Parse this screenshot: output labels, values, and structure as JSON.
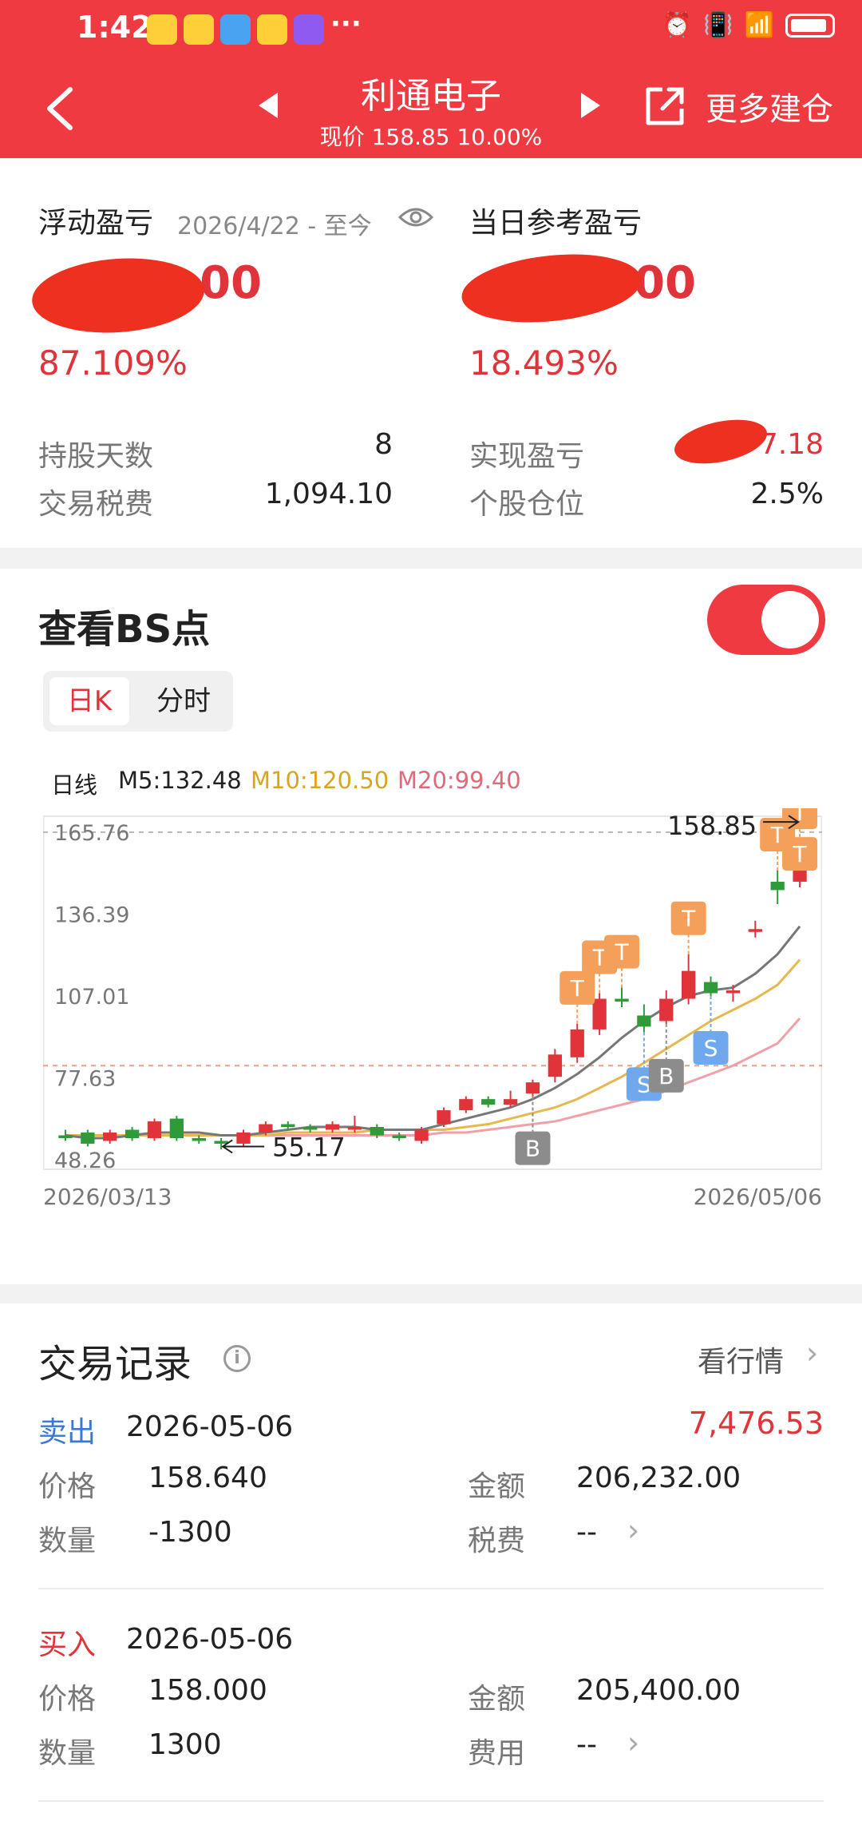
{
  "status_bar": {
    "time": "1:42",
    "notification_dots": "···"
  },
  "nav": {
    "title": "利通电子",
    "subtitle": "现价 158.85 10.00%",
    "more_label": "更多建仓"
  },
  "summary": {
    "floating_label": "浮动盈亏",
    "floating_range": "2026/4/22 - 至今",
    "floating_value_tail": ".00",
    "floating_pct": "87.109%",
    "daily_label": "当日参考盈亏",
    "daily_value_tail": "00",
    "daily_pct": "18.493%",
    "hold_days_label": "持股天数",
    "hold_days": "8",
    "fees_label": "交易税费",
    "fees": "1,094.10",
    "realized_label": "实现盈亏",
    "realized_tail": "7.18",
    "position_label": "个股仓位",
    "position": "2.5%"
  },
  "bs": {
    "title": "查看BS点",
    "tab_day": "日K",
    "tab_intraday": "分时",
    "ma_prefix": "日线",
    "ma5": "M5:132.48",
    "ma10": "M10:120.50",
    "ma20": "M20:99.40",
    "colors": {
      "up": "#e0343a",
      "down": "#2e9a3a",
      "ma5": "#777777",
      "ma10": "#e8b850",
      "ma20": "#f0a0a8",
      "t_marker": "#f5a05a",
      "buy_marker": "#8c8c8c",
      "sell_marker": "#6fa8ec"
    }
  },
  "chart_data": {
    "type": "candlestick",
    "y_ticks": [
      "165.76",
      "136.39",
      "107.01",
      "77.63",
      "48.26"
    ],
    "ylim": [
      48.26,
      165.76
    ],
    "x_labels": [
      "2026/03/13",
      "2026/05/06"
    ],
    "high_annotation": "158.85",
    "low_annotation": "55.17",
    "candles": [
      {
        "o": 57,
        "c": 56,
        "h": 59,
        "l": 55
      },
      {
        "o": 58,
        "c": 54,
        "h": 59,
        "l": 53
      },
      {
        "o": 55,
        "c": 58,
        "h": 59,
        "l": 54
      },
      {
        "o": 59,
        "c": 56,
        "h": 60,
        "l": 55
      },
      {
        "o": 56,
        "c": 62,
        "h": 63,
        "l": 55
      },
      {
        "o": 63,
        "c": 56,
        "h": 64,
        "l": 55
      },
      {
        "o": 56,
        "c": 55,
        "h": 57,
        "l": 54
      },
      {
        "o": 55,
        "c": 54,
        "h": 56,
        "l": 52
      },
      {
        "o": 54,
        "c": 58,
        "h": 59,
        "l": 53
      },
      {
        "o": 58,
        "c": 61,
        "h": 62,
        "l": 57
      },
      {
        "o": 61,
        "c": 60,
        "h": 62,
        "l": 59
      },
      {
        "o": 60,
        "c": 59,
        "h": 61,
        "l": 58
      },
      {
        "o": 59,
        "c": 61,
        "h": 62,
        "l": 58
      },
      {
        "o": 59,
        "c": 60,
        "h": 64,
        "l": 58
      },
      {
        "o": 60,
        "c": 57,
        "h": 61,
        "l": 56
      },
      {
        "o": 57,
        "c": 56,
        "h": 58,
        "l": 55
      },
      {
        "o": 55,
        "c": 59,
        "h": 60,
        "l": 54
      },
      {
        "o": 61,
        "c": 66,
        "h": 67,
        "l": 60
      },
      {
        "o": 66,
        "c": 70,
        "h": 71,
        "l": 65
      },
      {
        "o": 70,
        "c": 68,
        "h": 71,
        "l": 67
      },
      {
        "o": 68,
        "c": 70,
        "h": 73,
        "l": 67
      },
      {
        "o": 72,
        "c": 76,
        "h": 77,
        "l": 71
      },
      {
        "o": 78,
        "c": 86,
        "h": 88,
        "l": 76
      },
      {
        "o": 85,
        "c": 95,
        "h": 97,
        "l": 83
      },
      {
        "o": 95,
        "c": 106,
        "h": 108,
        "l": 93
      },
      {
        "o": 106,
        "c": 105,
        "h": 110,
        "l": 103
      },
      {
        "o": 100,
        "c": 96,
        "h": 104,
        "l": 94
      },
      {
        "o": 98,
        "c": 106,
        "h": 109,
        "l": 97
      },
      {
        "o": 106,
        "c": 116,
        "h": 122,
        "l": 104
      },
      {
        "o": 112,
        "c": 108,
        "h": 114,
        "l": 107
      },
      {
        "o": 108,
        "c": 109,
        "h": 111,
        "l": 105
      },
      {
        "o": 130,
        "c": 131,
        "h": 134,
        "l": 128
      },
      {
        "o": 148,
        "c": 145,
        "h": 152,
        "l": 140
      },
      {
        "o": 148,
        "c": 159,
        "h": 160,
        "l": 146
      }
    ],
    "markers": [
      {
        "label": "B",
        "candle": 21
      },
      {
        "label": "S",
        "candle": 26
      },
      {
        "label": "B",
        "candle": 27
      },
      {
        "label": "S",
        "candle": 29
      },
      {
        "label": "T",
        "candle": 23
      },
      {
        "label": "T",
        "candle": 24
      },
      {
        "label": "T",
        "candle": 25
      },
      {
        "label": "T",
        "candle": 28
      },
      {
        "label": "T",
        "candle": 32
      },
      {
        "label": "T",
        "candle": 33
      },
      {
        "label": "T",
        "candle": 33
      }
    ],
    "ma5": [
      57,
      56,
      56,
      57,
      58,
      58,
      58,
      57,
      57,
      58,
      59,
      60,
      60,
      60,
      59,
      59,
      59,
      61,
      63,
      65,
      67,
      70,
      74,
      79,
      85,
      92,
      98,
      103,
      107,
      109,
      110,
      115,
      122,
      132
    ],
    "ma10": [
      57,
      57,
      57,
      57,
      57,
      57,
      57,
      57,
      57,
      57,
      58,
      58,
      58,
      58,
      59,
      59,
      59,
      59,
      60,
      61,
      63,
      65,
      67,
      70,
      74,
      78,
      83,
      88,
      93,
      98,
      102,
      106,
      111,
      120
    ],
    "ma20": [
      57,
      57,
      57,
      57,
      57,
      57,
      57,
      57,
      57,
      57,
      57,
      57,
      57,
      57,
      57,
      57,
      57,
      58,
      58,
      59,
      60,
      61,
      62,
      64,
      66,
      68,
      70,
      73,
      76,
      79,
      82,
      86,
      90,
      99
    ]
  },
  "records": {
    "title": "交易记录",
    "market_link": "看行情",
    "items": [
      {
        "side": "卖出",
        "date": "2026-05-06",
        "profit": "7,476.53",
        "price_label": "价格",
        "price": "158.640",
        "amount_label": "金额",
        "amount": "206,232.00",
        "qty_label": "数量",
        "qty": "-1300",
        "fee_label": "税费",
        "fee": "--"
      },
      {
        "side": "买入",
        "date": "2026-05-06",
        "profit": "",
        "price_label": "价格",
        "price": "158.000",
        "amount_label": "金额",
        "amount": "205,400.00",
        "qty_label": "数量",
        "qty": "1300",
        "fee_label": "费用",
        "fee": "--"
      }
    ]
  }
}
